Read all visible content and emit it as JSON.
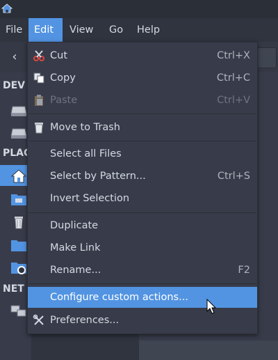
{
  "menubar": {
    "items": [
      {
        "label": "File"
      },
      {
        "label": "Edit"
      },
      {
        "label": "View"
      },
      {
        "label": "Go"
      },
      {
        "label": "Help"
      }
    ]
  },
  "toolbar": {
    "back_icon": "‹"
  },
  "sidebar": {
    "headings": [
      {
        "label": "DEV"
      },
      {
        "label": "PLAC"
      },
      {
        "label": "NET"
      }
    ]
  },
  "edit_menu": {
    "items": [
      {
        "label": "Cut",
        "accel": "Ctrl+X",
        "icon": "scissors-icon"
      },
      {
        "label": "Copy",
        "accel": "Ctrl+C",
        "icon": "copy-icon"
      },
      {
        "label": "Paste",
        "accel": "Ctrl+V",
        "icon": "paste-icon",
        "disabled": true
      },
      {
        "label": "Move to Trash",
        "accel": "",
        "icon": "trash-icon"
      },
      {
        "label": "Select all Files",
        "accel": ""
      },
      {
        "label": "Select by Pattern...",
        "accel": "Ctrl+S"
      },
      {
        "label": "Invert Selection",
        "accel": ""
      },
      {
        "label": "Duplicate",
        "accel": ""
      },
      {
        "label": "Make Link",
        "accel": ""
      },
      {
        "label": "Rename...",
        "accel": "F2"
      },
      {
        "label": "Configure custom actions...",
        "accel": "",
        "highlighted": true
      },
      {
        "label": "Preferences...",
        "accel": "",
        "icon": "preferences-icon"
      }
    ]
  },
  "colors": {
    "accent": "#5294e2",
    "background": "#2f343f",
    "menu_bg": "#383c4a",
    "text": "#d3dae3"
  }
}
